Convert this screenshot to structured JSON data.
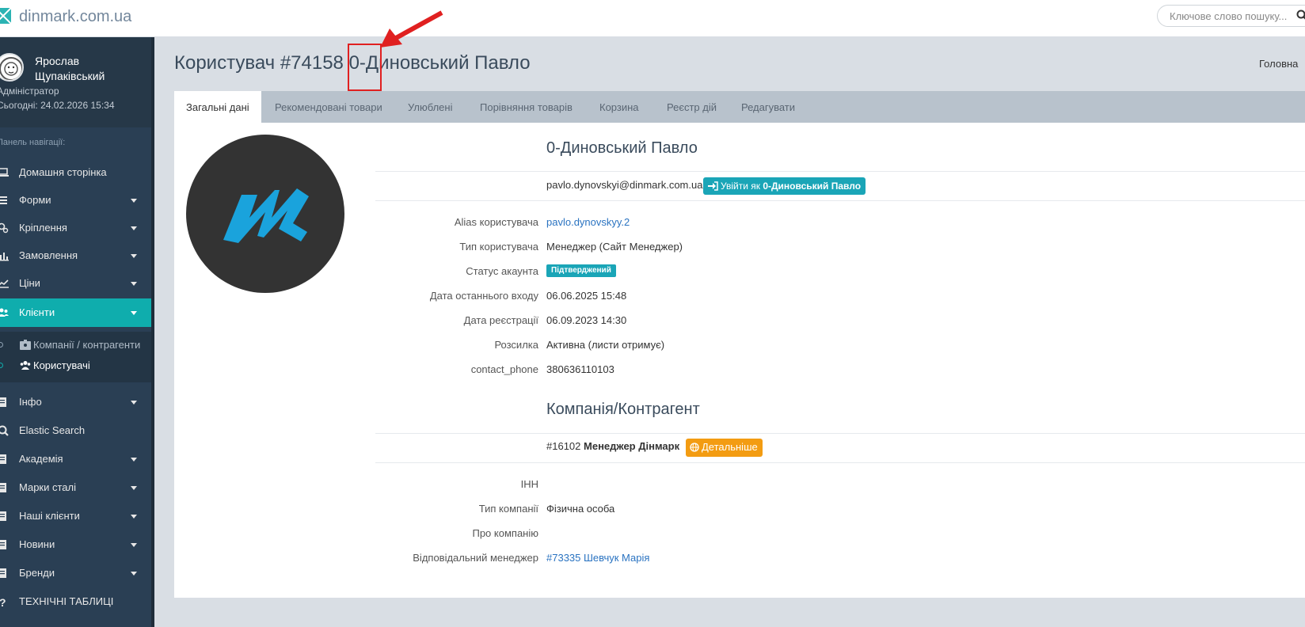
{
  "site": {
    "name": "dinmark.com.ua"
  },
  "search": {
    "placeholder": "Ключове слово пошуку..."
  },
  "profile": {
    "name": "Ярослав Щупаківський",
    "role": "Адміністратор",
    "today": "Сьогодні: 24.02.2026 15:34"
  },
  "sidebar": {
    "title": "Панель навігації:",
    "items": [
      {
        "label": "Домашня сторінка",
        "icon": "laptop-icon"
      },
      {
        "label": "Форми",
        "icon": "list-icon"
      },
      {
        "label": "Кріплення",
        "icon": "cogs-icon"
      },
      {
        "label": "Замовлення",
        "icon": "bar-chart-icon"
      },
      {
        "label": "Ціни",
        "icon": "line-chart-icon"
      },
      {
        "label": "Клієнти",
        "icon": "users-icon"
      },
      {
        "label": "Інфо",
        "icon": "book-icon"
      },
      {
        "label": "Elastic Search",
        "icon": "search-icon"
      },
      {
        "label": "Академія",
        "icon": "book-icon"
      },
      {
        "label": "Марки сталі",
        "icon": "book-icon"
      },
      {
        "label": "Наші клієнти",
        "icon": "book-icon"
      },
      {
        "label": "Новини",
        "icon": "book-icon"
      },
      {
        "label": "Бренди",
        "icon": "book-icon"
      },
      {
        "label": "ТЕХНІЧНІ ТАБЛИЦІ",
        "icon": "question-icon"
      }
    ],
    "subitems": [
      {
        "label": "Компанії / контрагенти",
        "icon": "id-badge-icon"
      },
      {
        "label": "Користувачі",
        "icon": "users-icon"
      }
    ]
  },
  "page": {
    "title": "Користувач #74158 0-Диновський Павло",
    "breadcrumb": "Головна"
  },
  "tabs": [
    "Загальні дані",
    "Рекомендовані товари",
    "Улюблені",
    "Порівняння товарів",
    "Корзина",
    "Реєстр дій",
    "Редагувати"
  ],
  "user": {
    "name": "0-Диновський Павло",
    "email": "pavlo.dynovskyi@dinmark.com.ua",
    "login_as_prefix": "Увійти як",
    "login_as_name": "0-Диновський Павло",
    "fields": [
      {
        "label": "Alias користувача",
        "value": "pavlo.dynovskyy.2"
      },
      {
        "label": "Тип користувача",
        "value": "Менеджер (Сайт Менеджер)"
      },
      {
        "label": "Статус акаунта",
        "value": "Підтверджений"
      },
      {
        "label": "Дата останнього входу",
        "value": "06.06.2025 15:48"
      },
      {
        "label": "Дата реєстрації",
        "value": "06.09.2023 14:30"
      },
      {
        "label": "Розсилка",
        "value": "Активна (листи отримує)"
      },
      {
        "label": "contact_phone",
        "value": "380636110103"
      }
    ]
  },
  "company": {
    "title": "Компанія/Контрагент",
    "number": "#16102",
    "name": "Менеджер Дінмарк",
    "details_label": "Детальніше",
    "fields": [
      {
        "label": "ІНН",
        "value": ""
      },
      {
        "label": "Тип компанії",
        "value": "Фізична особа"
      },
      {
        "label": "Про компанію",
        "value": ""
      },
      {
        "label": "Відповідальний менеджер",
        "value": "#73335 Шевчук Марія"
      }
    ]
  },
  "colors": {
    "sidebar": "#2a3f54",
    "active": "#0fadad",
    "accent": "#1aa5b7",
    "warning": "#f39c12",
    "annotation": "#e02020"
  }
}
